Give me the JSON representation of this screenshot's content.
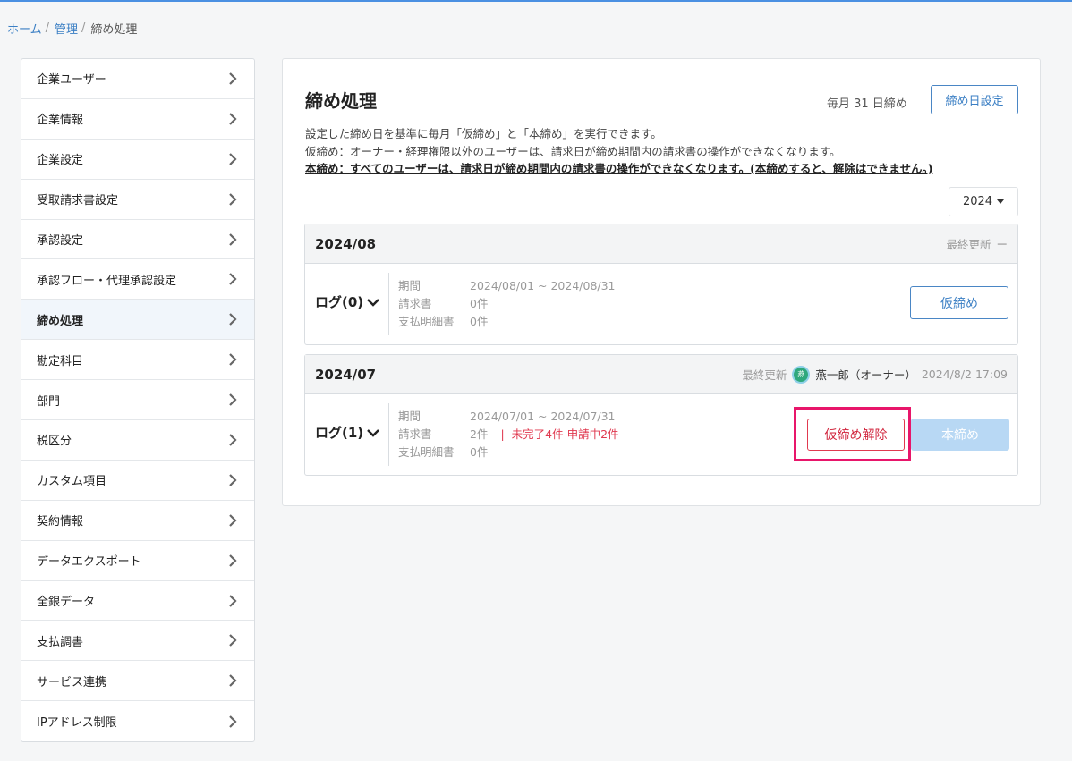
{
  "breadcrumb": {
    "home": "ホーム",
    "admin": "管理",
    "current": "締め処理",
    "sep": "/"
  },
  "sidebar": {
    "items": [
      {
        "label": "企業ユーザー"
      },
      {
        "label": "企業情報"
      },
      {
        "label": "企業設定"
      },
      {
        "label": "受取請求書設定"
      },
      {
        "label": "承認設定"
      },
      {
        "label": "承認フロー・代理承認設定"
      },
      {
        "label": "締め処理"
      },
      {
        "label": "勘定科目"
      },
      {
        "label": "部門"
      },
      {
        "label": "税区分"
      },
      {
        "label": "カスタム項目"
      },
      {
        "label": "契約情報"
      },
      {
        "label": "データエクスポート"
      },
      {
        "label": "全銀データ"
      },
      {
        "label": "支払調書"
      },
      {
        "label": "サービス連携"
      },
      {
        "label": "IPアドレス制限"
      }
    ]
  },
  "main": {
    "title": "締め処理",
    "cutoff_text": "毎月 31 日締め",
    "setting_button": "締め日設定",
    "desc_line1": "設定した締め日を基準に毎月「仮締め」と「本締め」を実行できます。",
    "desc_line2": "仮締め：オーナー・経理権限以外のユーザーは、請求日が締め期間内の請求書の操作ができなくなります。",
    "desc_line3": "本締め：すべてのユーザーは、請求日が締め期間内の請求書の操作ができなくなります。(本締めすると、解除はできません。)",
    "year": "2024"
  },
  "periods": [
    {
      "label": "2024/08",
      "updated_label": "最終更新",
      "updated_value": "ー",
      "log": "ログ(0)",
      "period_key": "期間",
      "period_value": "2024/08/01 ~ 2024/08/31",
      "invoice_key": "請求書",
      "invoice_value": "0件",
      "payment_key": "支払明細書",
      "payment_value": "0件",
      "button": "仮締め"
    },
    {
      "label": "2024/07",
      "updated_label": "最終更新",
      "avatar_text": "燕",
      "updated_user": "燕一郎（オーナー）",
      "updated_time": "2024/8/2 17:09",
      "log": "ログ(1)",
      "period_key": "期間",
      "period_value": "2024/07/01 ~ 2024/07/31",
      "invoice_key": "請求書",
      "invoice_value": "2件",
      "invoice_bar": "|",
      "invoice_alert": "未完了4件 申請中2件",
      "payment_key": "支払明細書",
      "payment_value": "0件",
      "release_button": "仮締め解除",
      "final_button": "本締め"
    }
  ],
  "colors": {
    "accent": "#3b7fc4",
    "danger": "#e0394f",
    "highlight": "#e8166a",
    "disabled": "#b8d8f4"
  }
}
